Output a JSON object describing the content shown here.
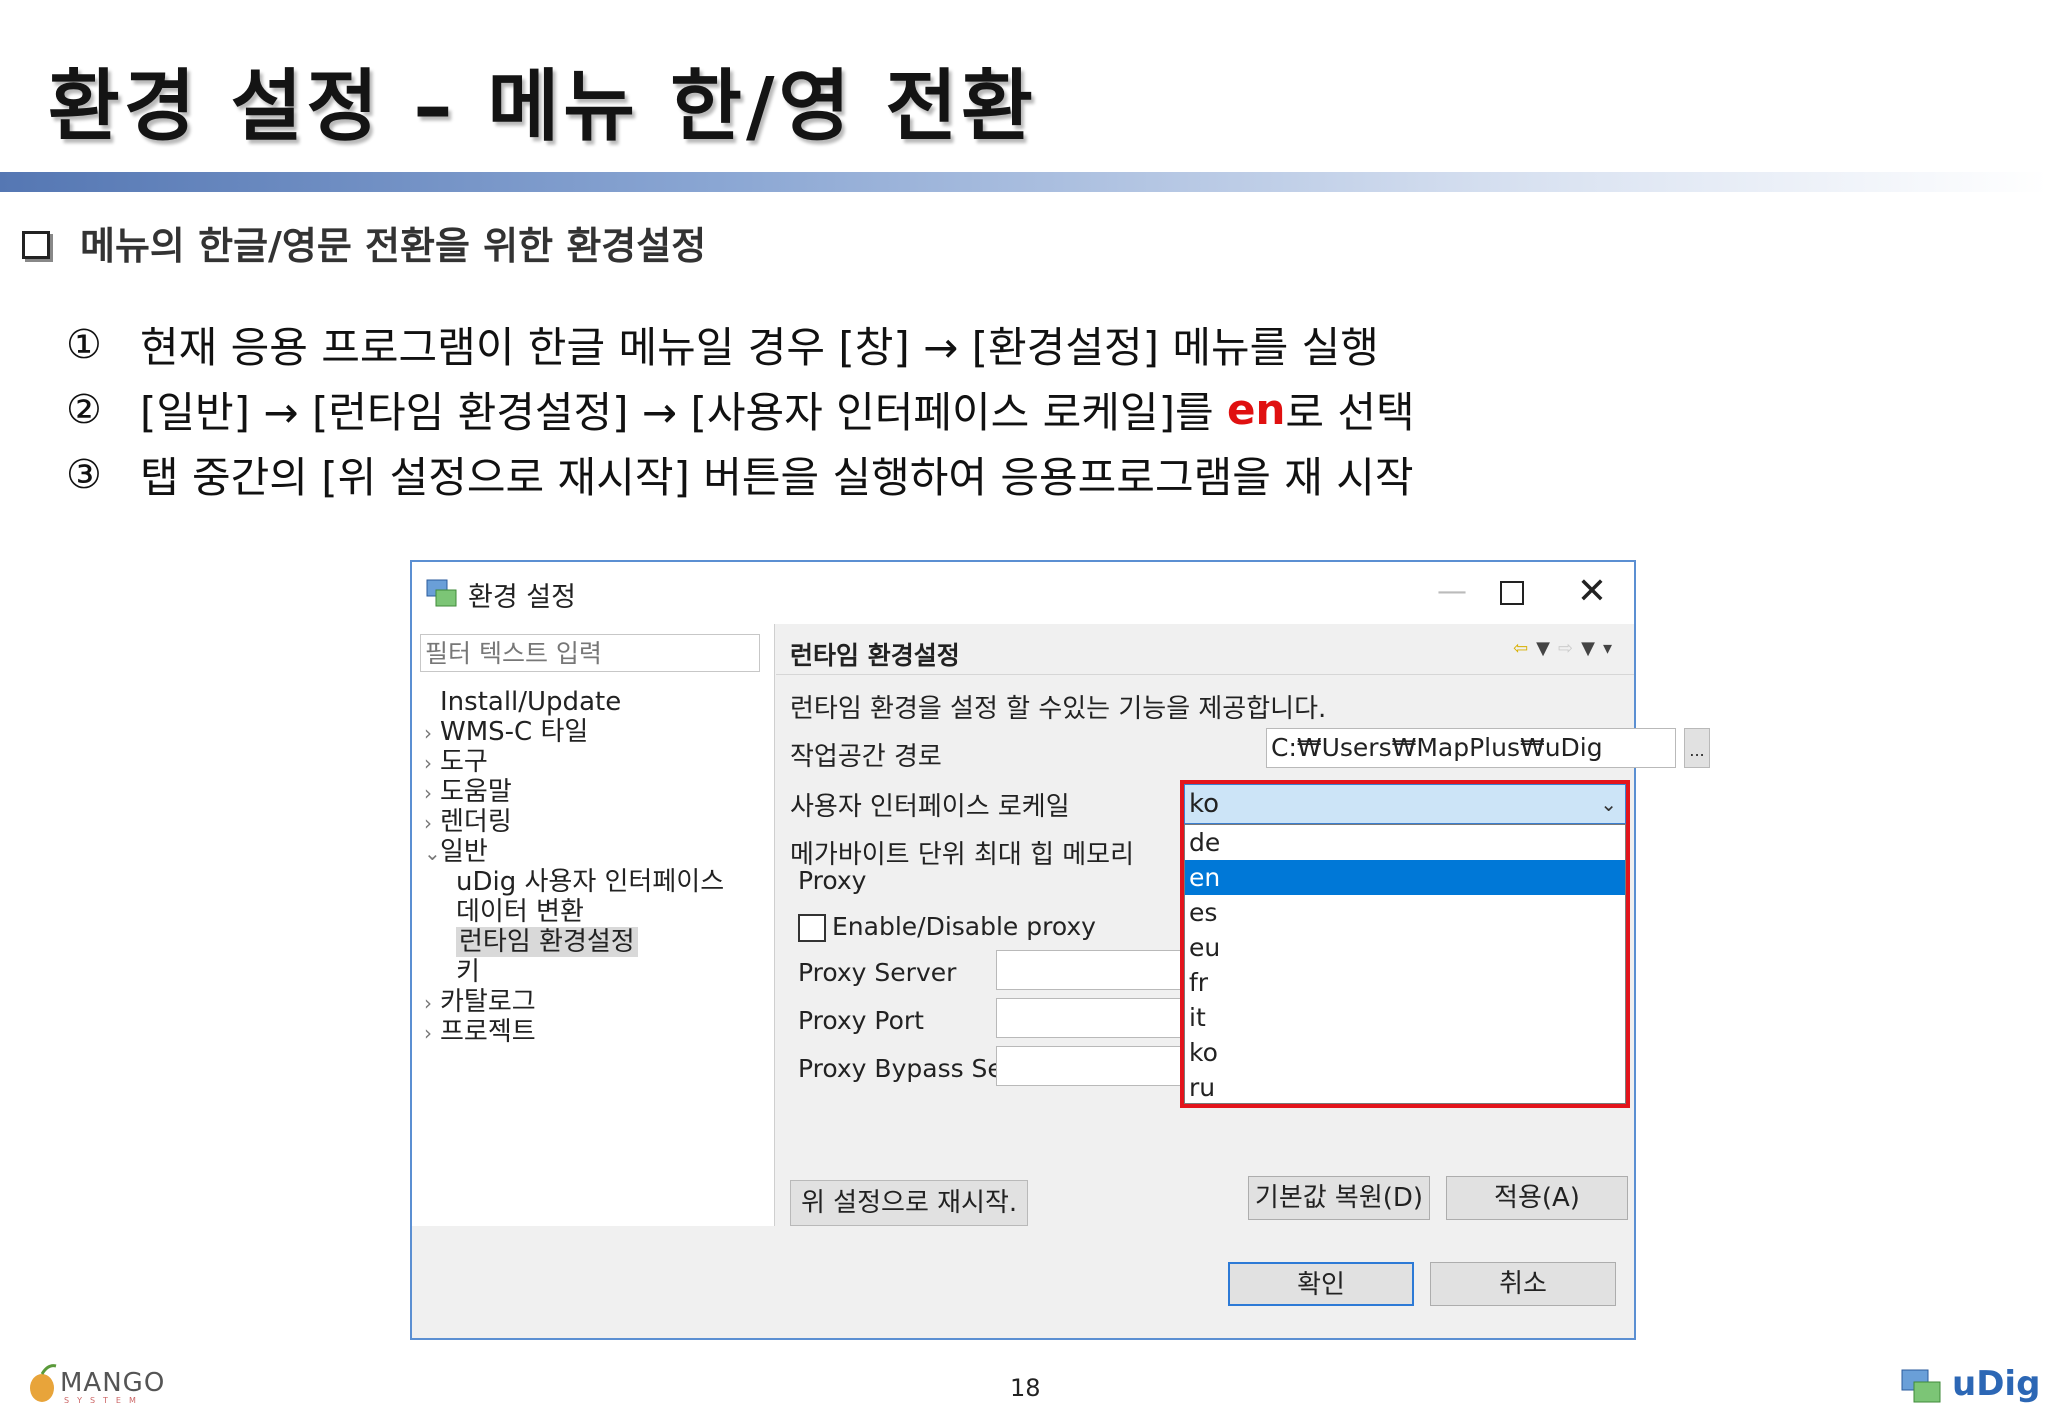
{
  "slide": {
    "title": "환경 설정 – 메뉴 한/영 전환",
    "section": "메뉴의 한글/영문 전환을 위한 환경설정",
    "steps": [
      {
        "num": "①",
        "text": "현재 응용 프로그램이 한글 메뉴일 경우 [창] → [환경설정] 메뉴를 실행"
      },
      {
        "num": "②",
        "text_before": "[일반] → [런타임 환경설정] → [사용자 인터페이스 로케일]를 ",
        "highlight": "en",
        "text_after": "로 선택"
      },
      {
        "num": "③",
        "text": "탭 중간의 [위 설정으로 재시작] 버튼을 실행하여 응용프로그램을 재 시작"
      }
    ],
    "highlight_color": "#e01010",
    "page_number": "18",
    "footer_logo_left": "MANGO",
    "footer_logo_left_sub": "SYSTEM",
    "footer_logo_right": "uDig"
  },
  "dialog": {
    "title": "환경 설정",
    "filter_placeholder": "필터 텍스트 입력",
    "tree": [
      {
        "label": "Install/Update",
        "arrow": ""
      },
      {
        "label": "WMS-C 타일",
        "arrow": "›"
      },
      {
        "label": "도구",
        "arrow": "›"
      },
      {
        "label": "도움말",
        "arrow": "›"
      },
      {
        "label": "렌더링",
        "arrow": "›"
      },
      {
        "label": "일반",
        "arrow": "⌄"
      },
      {
        "label": "uDig 사용자 인터페이스",
        "arrow": ""
      },
      {
        "label": "데이터 변환",
        "arrow": ""
      },
      {
        "label": "런타임 환경설정",
        "arrow": "",
        "selected": true
      },
      {
        "label": "키",
        "arrow": ""
      },
      {
        "label": "카탈로그",
        "arrow": "›"
      },
      {
        "label": "프로젝트",
        "arrow": "›"
      }
    ],
    "page_title": "런타임 환경설정",
    "description": "런타임 환경을 설정 할 수있는 기능을 제공합니다.",
    "workspace_label": "작업공간 경로",
    "workspace_value": "C:₩Users₩MapPlus₩uDig",
    "browse_label": "...",
    "locale_label": "사용자 인터페이스 로케일",
    "locale_value": "ko",
    "locale_options": [
      "de",
      "en",
      "es",
      "eu",
      "fr",
      "it",
      "ko",
      "ru"
    ],
    "locale_selected_option": "en",
    "memory_label": "메가바이트 단위 최대 힙 메모리",
    "proxy_title": "Proxy",
    "proxy_toggle_label": "Enable/Disable proxy",
    "proxy_toggle_checked": false,
    "proxy_server_label": "Proxy Server",
    "proxy_port_label": "Proxy Port",
    "proxy_bypass_label": "Proxy Bypass Servers",
    "restart_button": "위 설정으로 재시작.",
    "restore_defaults_button": "기본값 복원(D)",
    "apply_button": "적용(A)",
    "ok_button": "확인",
    "cancel_button": "취소",
    "highlight_frame_color": "#e3141c"
  }
}
